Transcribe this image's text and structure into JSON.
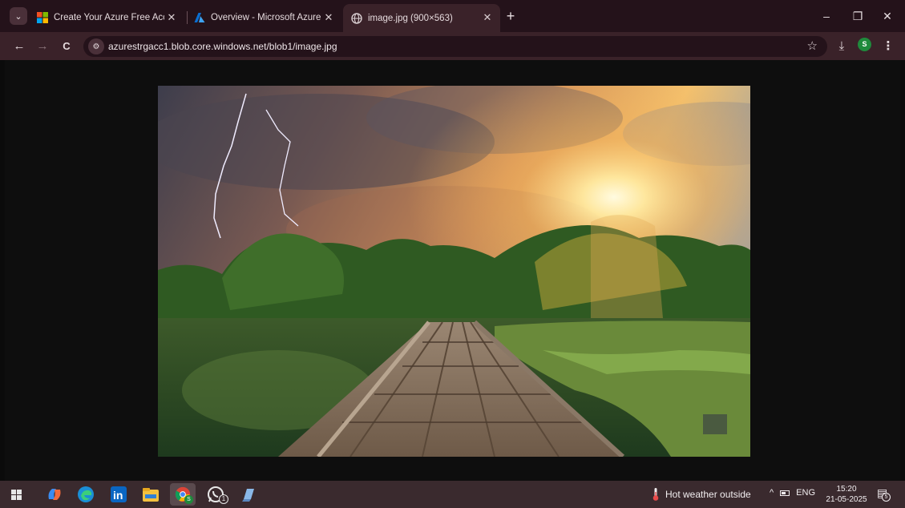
{
  "browser": {
    "tabs": [
      {
        "title": "Create Your Azure Free Account",
        "favicon": "microsoft-logo-icon",
        "active": false
      },
      {
        "title": "Overview - Microsoft Azure",
        "favicon": "azure-logo-icon",
        "active": false
      },
      {
        "title": "image.jpg (900×563)",
        "favicon": "globe-icon",
        "active": true
      }
    ],
    "tab_close_glyph": "✕",
    "new_tab_glyph": "+",
    "window_controls": {
      "minimize": "–",
      "restore": "❐",
      "close": "✕"
    },
    "nav": {
      "back": "←",
      "forward": "→",
      "reload": "C"
    },
    "address": {
      "site_info_glyph": "⚙",
      "url": "azurestrgacc1.blob.core.windows.net/blob1/image.jpg",
      "bookmark_glyph": "☆"
    },
    "download_glyph": "⤓",
    "profile_initial": "S",
    "menu_glyph": "⋮"
  },
  "viewer": {
    "image_alt_subject": "wooden-bridge-lake-sunset-lightning",
    "image_native_size": "900×563"
  },
  "taskbar": {
    "apps": [
      "windows-start-icon",
      "copilot-icon",
      "edge-icon",
      "linkedin-icon",
      "file-explorer-icon",
      "chrome-icon",
      "whatsapp-icon",
      "azure-storage-explorer-icon"
    ],
    "whatsapp_badge": "1",
    "chrome_profile_badge": "S",
    "weather_text": "Hot weather outside",
    "tray_chevron": "^",
    "language": "ENG",
    "time": "15:20",
    "date": "21-05-2025",
    "notification_count": "5"
  },
  "colors": {
    "tabstrip": "#24121a",
    "toolbar": "#3a2229",
    "viewer_bg": "#0e0e0e",
    "taskbar": "#3a2a2e"
  }
}
